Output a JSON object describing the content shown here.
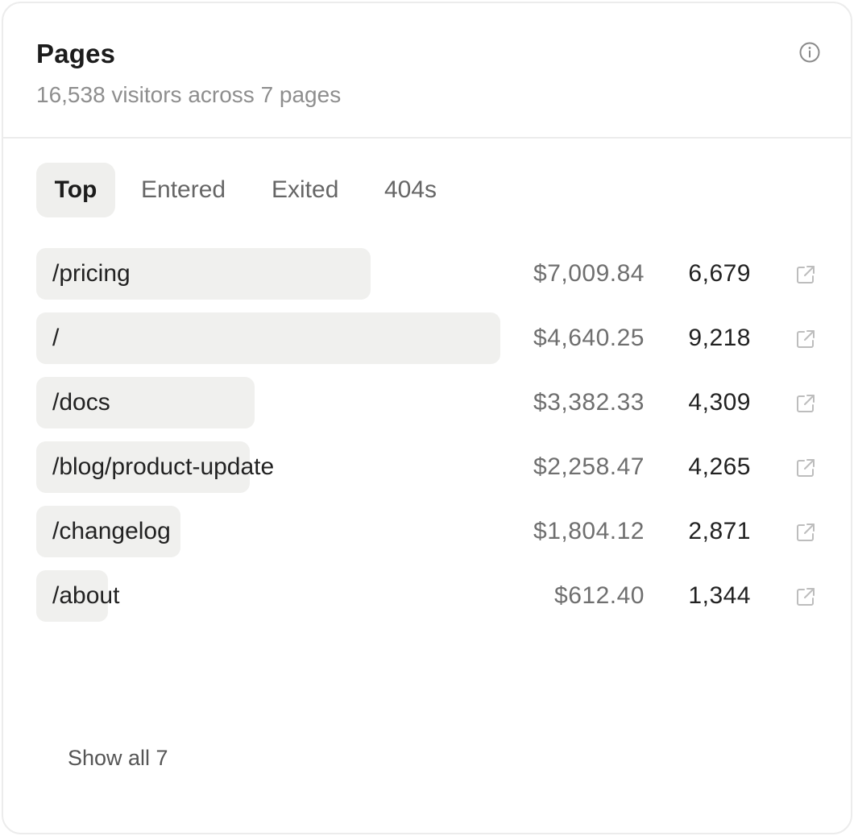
{
  "header": {
    "title": "Pages",
    "subtitle": "16,538 visitors across 7 pages"
  },
  "tabs": [
    {
      "label": "Top",
      "active": true
    },
    {
      "label": "Entered",
      "active": false
    },
    {
      "label": "Exited",
      "active": false
    },
    {
      "label": "404s",
      "active": false
    }
  ],
  "rows": [
    {
      "path": "/pricing",
      "revenue": "$7,009.84",
      "visitors": "6,679",
      "bar_fraction": 0.72
    },
    {
      "path": "/",
      "revenue": "$4,640.25",
      "visitors": "9,218",
      "bar_fraction": 1.0
    },
    {
      "path": "/docs",
      "revenue": "$3,382.33",
      "visitors": "4,309",
      "bar_fraction": 0.47
    },
    {
      "path": "/blog/product-update",
      "revenue": "$2,258.47",
      "visitors": "4,265",
      "bar_fraction": 0.46
    },
    {
      "path": "/changelog",
      "revenue": "$1,804.12",
      "visitors": "2,871",
      "bar_fraction": 0.31
    },
    {
      "path": "/about",
      "revenue": "$612.40",
      "visitors": "1,344",
      "bar_fraction": 0.155
    }
  ],
  "footer": {
    "show_all_label": "Show all 7"
  },
  "icons": {
    "info": "info-icon",
    "external_link": "external-link-icon"
  },
  "colors": {
    "bar": "#f0f0ee",
    "active_tab": "#efefed",
    "border": "#ececec",
    "muted_text": "#8e8e8e"
  }
}
